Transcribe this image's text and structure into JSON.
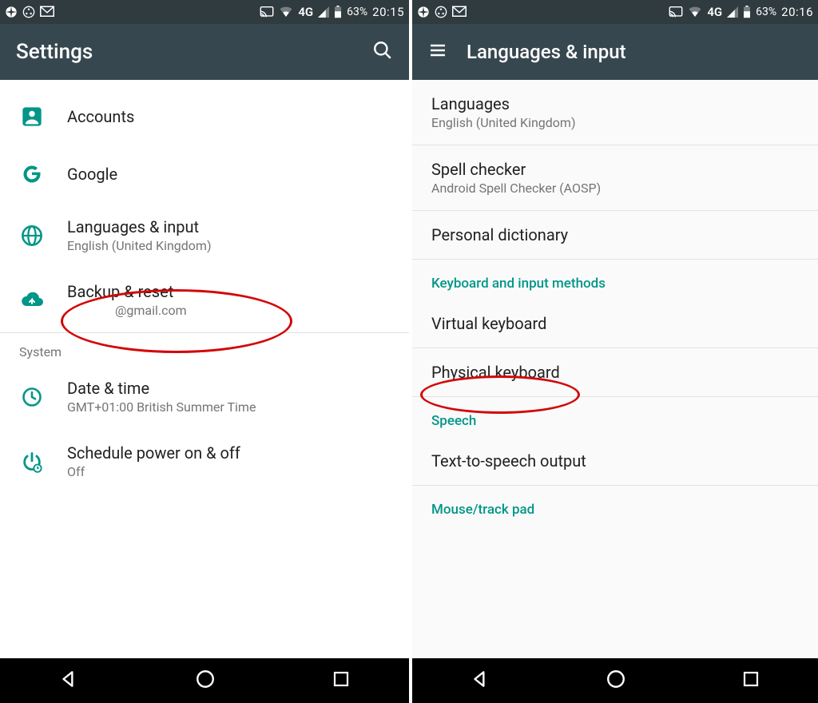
{
  "left": {
    "status": {
      "network_label": "4G",
      "battery_pct": "63%",
      "time": "20:15"
    },
    "appbar": {
      "title": "Settings"
    },
    "items": [
      {
        "title": "Accounts",
        "sub": ""
      },
      {
        "title": "Google",
        "sub": ""
      },
      {
        "title": "Languages & input",
        "sub": "English (United Kingdom)"
      },
      {
        "title": "Backup & reset",
        "sub": "@gmail.com"
      }
    ],
    "section_system": "System",
    "system_items": [
      {
        "title": "Date & time",
        "sub": "GMT+01:00 British Summer Time"
      },
      {
        "title": "Schedule power on & off",
        "sub": "Off"
      }
    ]
  },
  "right": {
    "status": {
      "network_label": "4G",
      "battery_pct": "63%",
      "time": "20:16"
    },
    "appbar": {
      "title": "Languages & input"
    },
    "items_top": [
      {
        "title": "Languages",
        "sub": "English (United Kingdom)"
      },
      {
        "title": "Spell checker",
        "sub": "Android Spell Checker (AOSP)"
      },
      {
        "title": "Personal dictionary",
        "sub": ""
      }
    ],
    "cat_keyboard": "Keyboard and input methods",
    "items_kb": [
      {
        "title": "Virtual keyboard",
        "sub": ""
      },
      {
        "title": "Physical keyboard",
        "sub": ""
      }
    ],
    "cat_speech": "Speech",
    "items_speech": [
      {
        "title": "Text-to-speech output",
        "sub": ""
      }
    ],
    "cat_mouse": "Mouse/track pad"
  }
}
